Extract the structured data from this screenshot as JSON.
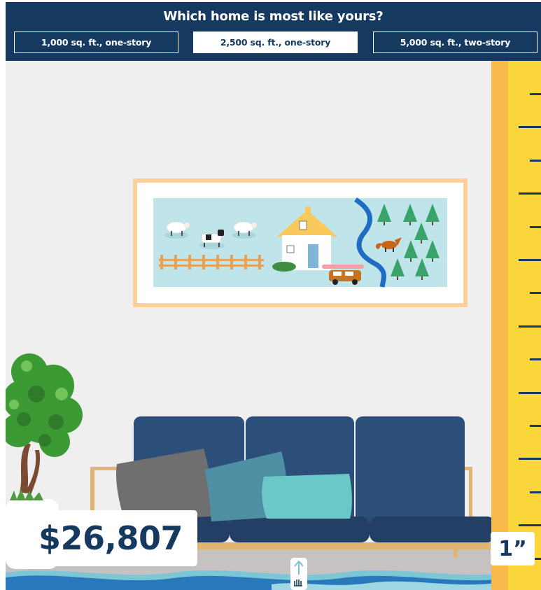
{
  "header": {
    "question": "Which home is most like yours?",
    "options": [
      {
        "label": "1,000 sq. ft., one-story",
        "selected": false
      },
      {
        "label": "2,500 sq. ft., one-story",
        "selected": true
      },
      {
        "label": "5,000 sq. ft., two-story",
        "selected": false
      }
    ]
  },
  "result": {
    "cost": "$26,807",
    "depth": "1”"
  },
  "colors": {
    "navy": "#163a5f",
    "wall": "#efefef",
    "ruler": "#fbd63a",
    "water": "#7cc6d6"
  },
  "icons": {
    "drag_handle": "arrow-up-hand-icon"
  }
}
